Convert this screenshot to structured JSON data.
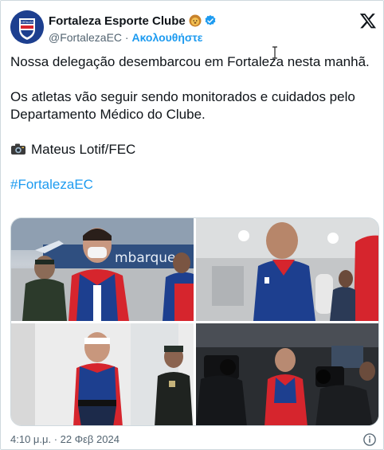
{
  "header": {
    "display_name": "Fortaleza Esporte Clube",
    "handle": "@FortalezaEC",
    "separator": " · ",
    "follow_label": "Ακολουθήστε",
    "avatar_text": "FORTALEZA"
  },
  "tweet": {
    "line1": "Nossa delegação desembarcou em Fortaleza nesta manhã.",
    "line2": "Os atletas vão seguir sendo monitorados e cuidados pelo Departamento Médico do Clube.",
    "photo_credit": "Mateus Lotif/FEC",
    "hashtag": "#FortalezaEC"
  },
  "media": {
    "photo1_sign": "mbarque"
  },
  "footer": {
    "timestamp": "4:10 μ.μ. · 22 Φεβ 2024"
  },
  "colors": {
    "accent": "#1d9bf0",
    "secondary_text": "#536471",
    "club_blue": "#1d3f8f",
    "club_red": "#d6252d"
  },
  "icons": [
    "lion-emoji-icon",
    "verified-badge-icon",
    "x-logo-icon",
    "camera-icon",
    "info-icon"
  ]
}
